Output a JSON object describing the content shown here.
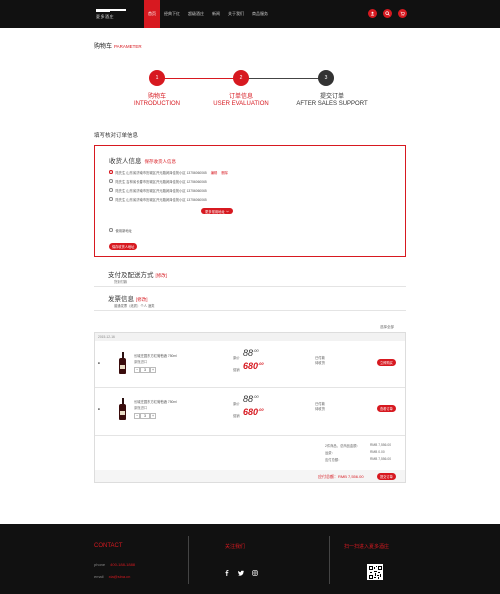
{
  "header": {
    "logo_text": "夏多酒庄",
    "nav": [
      "首页",
      "经典下红",
      "超级酒庄",
      "新闻",
      "关于我们",
      "商品服务"
    ]
  },
  "page": {
    "title": "购物车",
    "subtitle": "PARAMETER"
  },
  "steps": [
    {
      "num": "1",
      "cn": "购物车",
      "en": "INTRODUCTION"
    },
    {
      "num": "2",
      "cn": "订单信息",
      "en": "USER EVALUATION"
    },
    {
      "num": "3",
      "cn": "提交订单",
      "en": "AFTER SALES SUPPORT"
    }
  ],
  "form_title": "填写核对订单信息",
  "address": {
    "title": "收货人信息",
    "save_link": "保存收货人信息",
    "rows": [
      {
        "text": "陆先生   山东省济南市历城区开元路润泽佳苑小区   13756060065",
        "edit": "编辑",
        "del": "删除"
      },
      {
        "text": "陆先生   吉林省长春市历城区开元路润泽佳苑小区   12756060065"
      },
      {
        "text": "陆先生   山东省济南市历城区开元路润泽佳苑小区   13756060065"
      },
      {
        "text": "陆先生   山东省济南市历城区开元路润泽佳苑小区   13756060065"
      }
    ],
    "more_button": "更多常用地址",
    "new_address": "使用新地址",
    "save_button": "保存收货人地址"
  },
  "payment": {
    "title": "支付及配送方式",
    "edit": "[修改]",
    "detail": "货到付款"
  },
  "invoice": {
    "title": "发票信息",
    "edit": "[修改]",
    "detail": "普通发票（纸质）个人   酒类"
  },
  "select_all": "选择全部",
  "order": {
    "date": "2015-12-16",
    "items": [
      {
        "check": "■",
        "name": "长城庄园东方红葡萄酒  750ml",
        "sub": "原瓶进口",
        "qty": "3",
        "tag_old": "原价",
        "tag_new": "促销",
        "price_old": "88",
        "price_old_dec": ".00",
        "price_new": "680",
        "price_new_dec": ".00",
        "status1": "已付款",
        "status2": "待收货",
        "action": "立即购买"
      },
      {
        "check": "■",
        "name": "长城庄园东方红葡萄酒  750ml",
        "sub": "原瓶进口",
        "qty": "3",
        "tag_old": "原价",
        "tag_new": "促销",
        "price_old": "88",
        "price_old_dec": ".00",
        "price_new": "680",
        "price_new_dec": ".00",
        "status1": "已付款",
        "status2": "待收货",
        "action": "查看订单"
      }
    ],
    "summary": [
      {
        "label": "2件商品，总商品金额：",
        "value": "RMB 7,556.00"
      },
      {
        "label": "运费：",
        "value": "RMB 0.00"
      },
      {
        "label": "应付总额：",
        "value": "RMB 7,556.00"
      }
    ],
    "total": "应付总额：RMB 7,556.00",
    "pay_button": "提交订单"
  },
  "footer": {
    "contact_title": "CONTACT",
    "phone_label": "phone",
    "phone": "400-188-1888",
    "email_label": "email",
    "email": "xia@sina.cn",
    "follow_title": "关注我们",
    "qr_title": "扫一扫进入夏多酒庄"
  }
}
